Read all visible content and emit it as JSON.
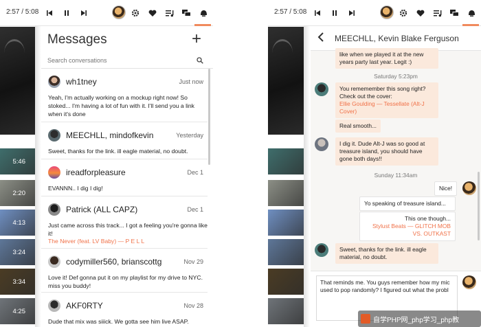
{
  "colors": {
    "accent": "#f08a5d",
    "link": "#f07148",
    "incoming_bubble": "#fbe9dc"
  },
  "player": {
    "time": "2:57 / 5:08"
  },
  "tiles": [
    {
      "duration": "5:46",
      "color": "#3f6e6c"
    },
    {
      "duration": "2:20",
      "color": "#8c8f86"
    },
    {
      "duration": "4:13",
      "color": "#6f8fc1"
    },
    {
      "duration": "3:24",
      "color": "#5e7799"
    },
    {
      "duration": "3:34",
      "color": "#4b3c24"
    },
    {
      "duration": "4:25",
      "color": "#6f7479"
    }
  ],
  "messages": {
    "title": "Messages",
    "search_placeholder": "Search conversations",
    "conversations": [
      {
        "name": "wh1tney",
        "time": "Just now",
        "preview": "Yeah, I'm actually working on a mockup right now! So stoked... I'm having a lot of fun with it. I'll send you a link when it's done",
        "link": ""
      },
      {
        "name": "MEECHLL, mindofkevin",
        "time": "Yesterday",
        "preview": "Sweet, thanks for the link. ill eagle material, no doubt.",
        "link": ""
      },
      {
        "name": "ireadforpleasure",
        "time": "Dec 1",
        "preview": "EVANNN.. I dig I dig!",
        "link": ""
      },
      {
        "name": "Patrick (ALL CAPZ)",
        "time": "Dec 1",
        "preview": "Just came across this track... I got a feeling you're gonna like it!",
        "link": "The Never (feat. LV Baby) — P E L L"
      },
      {
        "name": "codymiller560, brianscottg",
        "time": "Nov 29",
        "preview": "Love it! Def gonna put it on my playlist for my drive to NYC. miss you buddy!",
        "link": ""
      },
      {
        "name": "AKF0RTY",
        "time": "Nov 28",
        "preview": "Dude that mix was siiick. We gotta see him live ASAP.",
        "link": ""
      }
    ]
  },
  "chat": {
    "title": "MEECHLL, Kevin Blake Ferguson",
    "msg_top": "like when we played it at the new years party last year. Legit :)",
    "stamp1": "Saturday 5:23pm",
    "msg_cover": "You rememember this song right? Check out the cover:",
    "cover_link": "Ellie Goulding — Tessellate (Alt-J Cover)",
    "msg_smooth": "Real smooth...",
    "msg_dig": "I dig it. Dude Alt-J was so good at treasure island, you should have gone both days!!",
    "stamp2": "Sunday 11:34am",
    "msg_nice": "Nice!",
    "msg_speaking": "Yo speaking of treasure island...",
    "msg_thisone": "This one though...",
    "thisone_link": "Stylust Beats — GLITCH MOB VS. OUTKAST",
    "msg_sweet": "Sweet, thanks for the link. ill eagle material, no doubt.",
    "composer_text": "That reminds me. You guys remember how my mic used to pop randomly? I figured out what the probl"
  },
  "watermark": {
    "text": "自学PHP网_php学习_php教"
  }
}
